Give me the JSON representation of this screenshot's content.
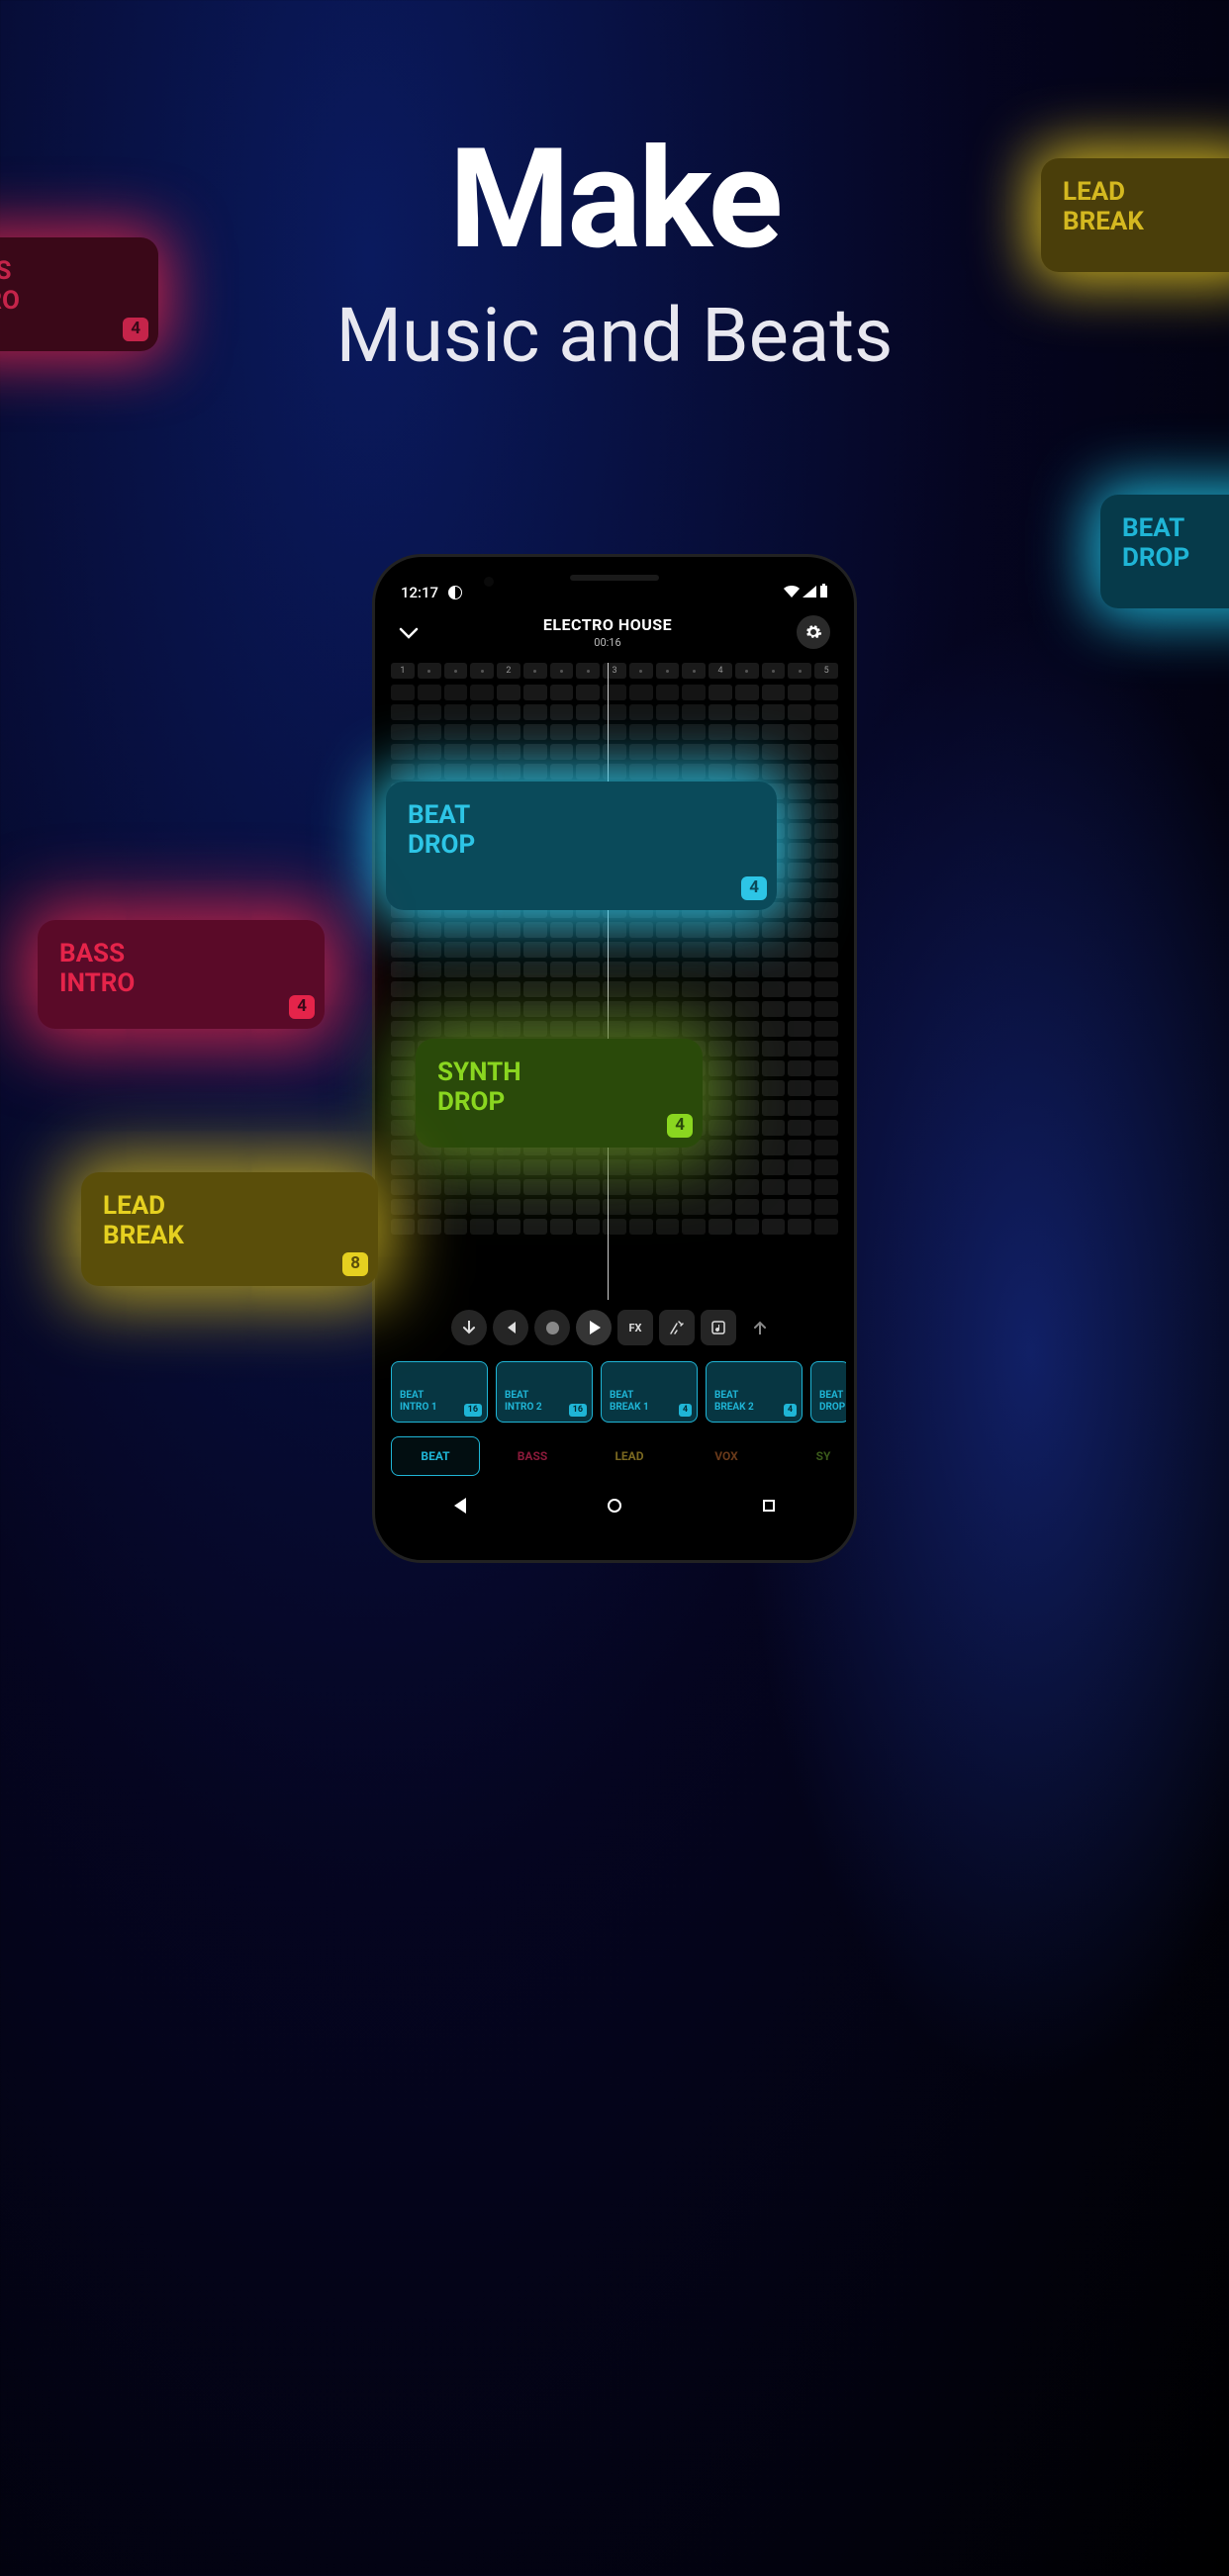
{
  "hero": {
    "title": "Make",
    "subtitle": "Music and Beats"
  },
  "status": {
    "time": "12:17"
  },
  "header": {
    "title": "ELECTRO HOUSE",
    "elapsed": "00:16"
  },
  "ruler": [
    "1",
    "·",
    "·",
    "·",
    "2",
    "·",
    "·",
    "·",
    "3",
    "·",
    "·",
    "·",
    "4",
    "·",
    "·",
    "·",
    "5"
  ],
  "transport": {
    "fx": "FX"
  },
  "clips": [
    {
      "l1": "BEAT",
      "l2": "INTRO 1",
      "badge": "16"
    },
    {
      "l1": "BEAT",
      "l2": "INTRO 2",
      "badge": "16"
    },
    {
      "l1": "BEAT",
      "l2": "BREAK 1",
      "badge": "4"
    },
    {
      "l1": "BEAT",
      "l2": "BREAK 2",
      "badge": "4"
    },
    {
      "l1": "BEAT",
      "l2": "DROP",
      "badge": ""
    }
  ],
  "cats": {
    "beat": "BEAT",
    "bass": "BASS",
    "lead": "LEAD",
    "vox": "VOX",
    "synth": "SY"
  },
  "floats": {
    "f1": {
      "l1": "ASS",
      "l2": "ITRO",
      "badge": "4"
    },
    "f2": {
      "l1": "LEAD",
      "l2": "BREAK"
    },
    "f3": {
      "l1": "BEAT",
      "l2": "DROP"
    },
    "f4": {
      "l1": "BEAT",
      "l2": "DROP",
      "badge": "4"
    },
    "f5": {
      "l1": "BASS",
      "l2": "INTRO",
      "badge": "4"
    },
    "f6": {
      "l1": "SYNTH",
      "l2": "DROP",
      "badge": "4"
    },
    "f7": {
      "l1": "LEAD",
      "l2": "BREAK",
      "badge": "8"
    }
  }
}
